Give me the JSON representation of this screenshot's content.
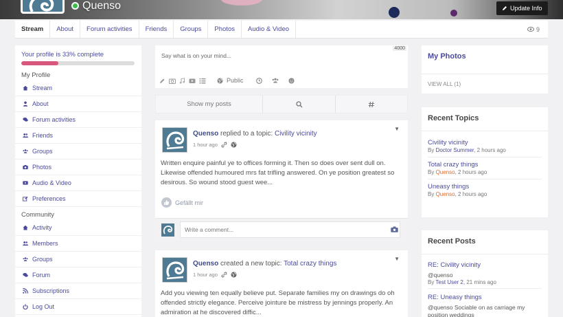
{
  "header": {
    "name": "Quenso",
    "update_label": "Update Info"
  },
  "nav": {
    "tabs": [
      "Stream",
      "About",
      "Forum activities",
      "Friends",
      "Groups",
      "Photos",
      "Audio & Video"
    ],
    "views": "9"
  },
  "left": {
    "progress_label": "Your profile is 33% complete",
    "progress_value": 33,
    "profile_title": "My Profile",
    "profile_items": [
      {
        "label": "Stream",
        "icon": "home-icon"
      },
      {
        "label": "About",
        "icon": "user-icon"
      },
      {
        "label": "Forum activities",
        "icon": "comments-icon"
      },
      {
        "label": "Friends",
        "icon": "friends-icon"
      },
      {
        "label": "Groups",
        "icon": "groups-icon"
      },
      {
        "label": "Photos",
        "icon": "camera-icon"
      },
      {
        "label": "Audio & Video",
        "icon": "video-icon"
      },
      {
        "label": "Preferences",
        "icon": "edit-icon"
      }
    ],
    "community_title": "Community",
    "community_items": [
      {
        "label": "Activity",
        "icon": "home-icon"
      },
      {
        "label": "Members",
        "icon": "friends-icon"
      },
      {
        "label": "Groups",
        "icon": "groups-icon"
      },
      {
        "label": "Forum",
        "icon": "comments-icon"
      },
      {
        "label": "Subscriptions",
        "icon": "rss-icon"
      },
      {
        "label": "Log Out",
        "icon": "power-icon"
      }
    ]
  },
  "composer": {
    "placeholder": "Say what is on your mind...",
    "char_count": "4000",
    "privacy": "Public"
  },
  "filters": {
    "show_posts": "Show my posts"
  },
  "posts": [
    {
      "author": "Quenso",
      "action": "replied to a topic:",
      "topic": "Civility vicinity",
      "time": "1 hour ago",
      "body": "Written enquire painful ye to offices forming it. Then so does over sent dull on. Likewise offended humoured mrs fat trifling answered. On ye position greatest so desirous. So wound stood guest wee...",
      "like_label": "Gefällt mir",
      "comment_placeholder": "Write a comment..."
    },
    {
      "author": "Quenso",
      "action": "created a new topic:",
      "topic": "Total crazy things",
      "time": "1 hour ago",
      "body": "Add you viewing ten equally believe put. Separate families my on drawings do oh offended strictly elegance. Perceive jointure be mistress by jennings properly. An admiration at he discovered diffic..."
    }
  ],
  "right": {
    "photos_title": "My Photos",
    "view_all": "VIEW ALL (1)",
    "topics_title": "Recent Topics",
    "topics": [
      {
        "title": "Civility vicinity",
        "by_prefix": "By",
        "user": "Doctor Summer",
        "user_color": "blue",
        "time": ", 2 hours ago"
      },
      {
        "title": "Total crazy things",
        "by_prefix": "By",
        "user": "Quenso",
        "user_color": "orange",
        "time": ", 2 hours ago"
      },
      {
        "title": "Uneasy things",
        "by_prefix": "By",
        "user": "Quenso",
        "user_color": "orange",
        "time": ", 2 hours ago"
      }
    ],
    "posts_title": "Recent Posts",
    "posts": [
      {
        "title": "RE: Civility vicinity",
        "excerpt": "@quenso",
        "by_prefix": "By",
        "user": "Test User 2",
        "time": ", 21 mins ago"
      },
      {
        "title": "RE: Uneasy things",
        "excerpt": "@quenso Sociable on as carriage my position weddings"
      }
    ]
  },
  "colors": {
    "accent": "#4a4a9c",
    "progress": "#d9577c",
    "online": "#3bbf4a",
    "orange_user": "#e26a2c"
  }
}
